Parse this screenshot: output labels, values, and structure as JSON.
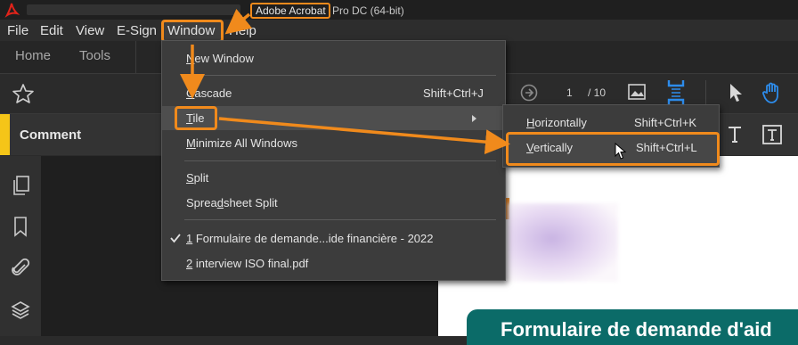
{
  "title_bar": {
    "app_name": "Adobe Acrobat",
    "app_name_rest": "Pro DC (64-bit)"
  },
  "menu_bar": {
    "items": [
      "File",
      "Edit",
      "View",
      "E-Sign",
      "Window",
      "Help"
    ]
  },
  "tabs": [
    "Home",
    "Tools"
  ],
  "toolbar": {
    "page_current": "1",
    "page_total": "/ 10"
  },
  "comment_bar": {
    "label": "Comment"
  },
  "window_menu": {
    "items": [
      {
        "label": "New Window",
        "mnemonic": "N",
        "shortcut": ""
      },
      {
        "label": "Cascade",
        "mnemonic": "C",
        "shortcut": "Shift+Ctrl+J"
      },
      {
        "label": "Tile",
        "mnemonic": "T",
        "shortcut": ""
      },
      {
        "label": "Minimize All Windows",
        "mnemonic": "M",
        "shortcut": ""
      },
      {
        "label": "Split",
        "mnemonic": "S",
        "shortcut": ""
      },
      {
        "label": "Spreadsheet Split",
        "mnemonic": "d",
        "shortcut": ""
      },
      {
        "label": "1 Formulaire de demande...ide financière - 2022",
        "mnemonic": "1",
        "shortcut": "",
        "checked": true
      },
      {
        "label": "2 interview ISO final.pdf",
        "mnemonic": "2",
        "shortcut": ""
      }
    ]
  },
  "tile_submenu": {
    "items": [
      {
        "label": "Horizontally",
        "mnemonic": "H",
        "shortcut": "Shift+Ctrl+K"
      },
      {
        "label": "Vertically",
        "mnemonic": "V",
        "shortcut": "Shift+Ctrl+L"
      }
    ]
  },
  "document": {
    "banner_title": "Formulaire de demande d'aid"
  },
  "colors": {
    "highlight": "#f08a1c",
    "comment_accent": "#f5c518",
    "banner": "#0b6b68"
  }
}
